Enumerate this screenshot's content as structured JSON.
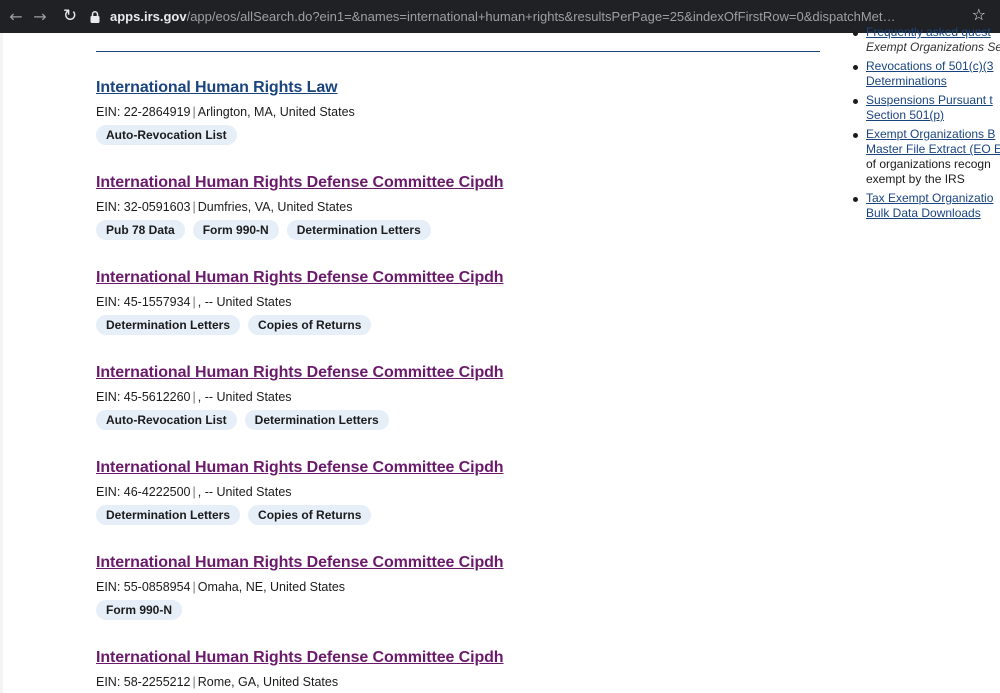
{
  "browser": {
    "url_host": "apps.irs.gov",
    "url_path": "/app/eos/allSearch.do?ein1=&names=international+human+rights&resultsPerPage=25&indexOfFirstRow=0&dispatchMethod=searchAll&cit...",
    "back_icon": "arrow-left-icon",
    "forward_icon": "arrow-right-icon",
    "reload_icon": "reload-icon",
    "bookmark_icon": "star-icon"
  },
  "sidebar": {
    "items": [
      {
        "lines": [
          "Frequently asked quest",
          "Exempt Organizations Se"
        ]
      },
      {
        "lines": [
          "Revocations of 501(c)(3",
          "Determinations"
        ]
      },
      {
        "lines": [
          "Suspensions Pursuant t",
          "Section 501(p)"
        ]
      },
      {
        "lines": [
          "Exempt Organizations B",
          "Master File Extract (EO E"
        ],
        "desc": [
          "of organizations recogn",
          "exempt by the IRS"
        ]
      },
      {
        "lines": [
          "Tax Exempt Organizatio",
          "Bulk Data Downloads"
        ]
      }
    ]
  },
  "results": [
    {
      "title": "International Human Rights Law",
      "ein_label": "EIN: 22-2864919",
      "location": "Arlington, MA, United States",
      "tags": [
        "Auto-Revocation List"
      ]
    },
    {
      "title": "International Human Rights Defense Committee Cipdh",
      "ein_label": "EIN: 32-0591603",
      "location": "Dumfries, VA, United States",
      "tags": [
        "Pub 78 Data",
        "Form 990-N",
        "Determination Letters"
      ]
    },
    {
      "title": "International Human Rights Defense Committee Cipdh",
      "ein_label": "EIN: 45-1557934",
      "location": ", -- United States",
      "tags": [
        "Determination Letters",
        "Copies of Returns"
      ]
    },
    {
      "title": "International Human Rights Defense Committee Cipdh",
      "ein_label": "EIN: 45-5612260",
      "location": ", -- United States",
      "tags": [
        "Auto-Revocation List",
        "Determination Letters"
      ]
    },
    {
      "title": "International Human Rights Defense Committee Cipdh",
      "ein_label": "EIN: 46-4222500",
      "location": ", -- United States",
      "tags": [
        "Determination Letters",
        "Copies of Returns"
      ]
    },
    {
      "title": "International Human Rights Defense Committee Cipdh",
      "ein_label": "EIN: 55-0858954",
      "location": "Omaha, NE, United States",
      "tags": [
        "Form 990-N"
      ]
    },
    {
      "title": "International Human Rights Defense Committee Cipdh",
      "ein_label": "EIN: 58-2255212",
      "location": "Rome, GA, United States",
      "tags": []
    }
  ],
  "colors": {
    "link": "#1a4480",
    "visited": "#6b1a6b",
    "tag_bg": "#e6eef8",
    "browser_bg": "#202124"
  }
}
